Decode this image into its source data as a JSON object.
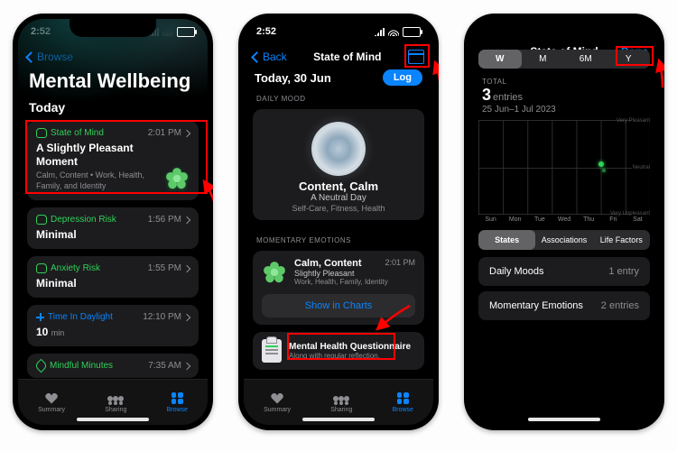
{
  "status": {
    "time": "2:52"
  },
  "phone1": {
    "back": "Browse",
    "title": "Mental Wellbeing",
    "section": "Today",
    "card_som": {
      "label": "State of Mind",
      "time": "2:01 PM",
      "title": "A Slightly Pleasant Moment",
      "sub": "Calm, Content • Work, Health, Family, and Identity"
    },
    "card_dep": {
      "label": "Depression Risk",
      "time": "1:56 PM",
      "value": "Minimal"
    },
    "card_anx": {
      "label": "Anxiety Risk",
      "time": "1:55 PM",
      "value": "Minimal"
    },
    "card_daylight": {
      "label": "Time In Daylight",
      "time": "12:10 PM",
      "value": "10",
      "unit": "min"
    },
    "card_mindful": {
      "label": "Mindful Minutes",
      "time": "7:35 AM"
    }
  },
  "tabs": {
    "summary": "Summary",
    "sharing": "Sharing",
    "browse": "Browse"
  },
  "phone2": {
    "back": "Back",
    "title": "State of Mind",
    "date": "Today, 30 Jun",
    "log": "Log",
    "daily_label": "DAILY MOOD",
    "mood_title": "Content, Calm",
    "mood_sub1": "A Neutral Day",
    "mood_sub2": "Self-Care, Fitness, Health",
    "mom_label": "MOMENTARY EMOTIONS",
    "mom_title": "Calm, Content",
    "mom_time": "2:01 PM",
    "mom_sub1": "Slightly Pleasant",
    "mom_sub2": "Work, Health, Family, Identity",
    "show": "Show in Charts",
    "quest_title": "Mental Health Questionnaire",
    "quest_sub": "Along with regular reflection,"
  },
  "phone3": {
    "title": "State of Mind",
    "done": "Done",
    "seg": {
      "w": "W",
      "m": "M",
      "sixm": "6M",
      "y": "Y"
    },
    "total_label": "TOTAL",
    "total_val": "3",
    "total_unit": "entries",
    "range": "25 Jun–1 Jul 2023",
    "yscale": {
      "top": "Very Pleasant",
      "mid": "Neutral",
      "bot": "Very Unpleasant"
    },
    "days": [
      "Sun",
      "Mon",
      "Tue",
      "Wed",
      "Thu",
      "Fri",
      "Sat"
    ],
    "seg2": {
      "states": "States",
      "assoc": "Associations",
      "life": "Life Factors"
    },
    "row_moods": {
      "label": "Daily Moods",
      "count": "1 entry"
    },
    "row_mom": {
      "label": "Momentary Emotions",
      "count": "2 entries"
    }
  }
}
